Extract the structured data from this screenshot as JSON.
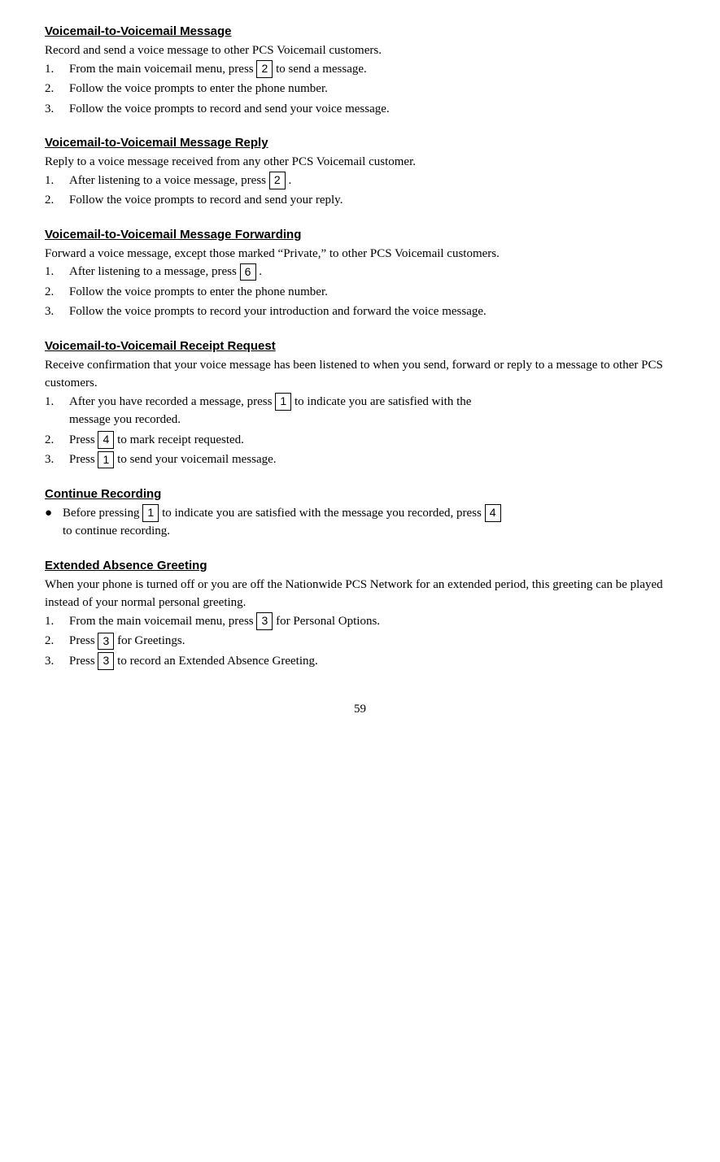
{
  "sections": [
    {
      "id": "v2v-message",
      "title": "Voicemail-to-Voicemail Message",
      "intro": "Record and send a voice message to other PCS Voicemail customers.",
      "items": [
        {
          "num": "1.",
          "text_before": "From the main voicemail menu, press ",
          "key": "2",
          "text_after": " to send a message."
        },
        {
          "num": "2.",
          "text_before": "Follow the voice prompts to enter the phone number.",
          "key": "",
          "text_after": ""
        },
        {
          "num": "3.",
          "text_before": "Follow the voice prompts to record and send your voice message.",
          "key": "",
          "text_after": ""
        }
      ],
      "type": "numbered"
    },
    {
      "id": "v2v-reply",
      "title": "Voicemail-to-Voicemail Message Reply",
      "intro": "Reply to a voice message received from any other PCS Voicemail customer.",
      "items": [
        {
          "num": "1.",
          "text_before": "After listening to a voice message, press ",
          "key": "2",
          "text_after": "."
        },
        {
          "num": "2.",
          "text_before": "Follow the voice prompts to record and send your reply.",
          "key": "",
          "text_after": ""
        }
      ],
      "type": "numbered"
    },
    {
      "id": "v2v-forwarding",
      "title": "Voicemail-to-Voicemail Message Forwarding",
      "intro": "Forward a voice message, except those marked “Private,” to other PCS Voicemail customers.",
      "items": [
        {
          "num": "1.",
          "text_before": "After listening to a message, press ",
          "key": "6",
          "text_after": "."
        },
        {
          "num": "2.",
          "text_before": "Follow the voice prompts to enter the phone number.",
          "key": "",
          "text_after": ""
        },
        {
          "num": "3.",
          "text_before": "Follow the voice prompts to record your introduction and forward the voice message.",
          "key": "",
          "text_after": ""
        }
      ],
      "type": "numbered"
    },
    {
      "id": "v2v-receipt",
      "title": "Voicemail-to-Voicemail Receipt Request",
      "intro": "Receive confirmation that your voice message has been listened to when you send, forward or reply to a message to other PCS customers.",
      "items": [
        {
          "num": "1.",
          "text_before": "After you have recorded a message, press ",
          "key": "1",
          "text_after": " to indicate you are satisfied with the",
          "subtext": "message you recorded."
        },
        {
          "num": "2.",
          "text_before": "Press ",
          "key": "4",
          "text_after": " to mark receipt requested."
        },
        {
          "num": "3.",
          "text_before": "Press ",
          "key": "1",
          "text_after": " to send your voicemail message."
        }
      ],
      "type": "numbered"
    },
    {
      "id": "continue-recording",
      "title": "Continue Recording",
      "items": [
        {
          "text_before": "Before pressing ",
          "key1": "1",
          "text_middle": " to indicate you are satisfied with the message you recorded, press ",
          "key2": "4",
          "text_after": " to continue recording."
        }
      ],
      "type": "bullet"
    },
    {
      "id": "extended-absence",
      "title": "Extended Absence Greeting",
      "intro": "When your phone is turned off or you are off the Nationwide PCS Network for an extended period, this greeting can be played instead of your normal personal greeting.",
      "items": [
        {
          "num": "1.",
          "text_before": "From the main voicemail menu, press ",
          "key": "3",
          "text_after": " for Personal Options."
        },
        {
          "num": "2.",
          "text_before": "Press ",
          "key": "3",
          "text_after": " for Greetings."
        },
        {
          "num": "3.",
          "text_before": "Press ",
          "key": "3",
          "text_after": " to record an Extended Absence Greeting."
        }
      ],
      "type": "numbered"
    }
  ],
  "footer": {
    "page_number": "59"
  }
}
